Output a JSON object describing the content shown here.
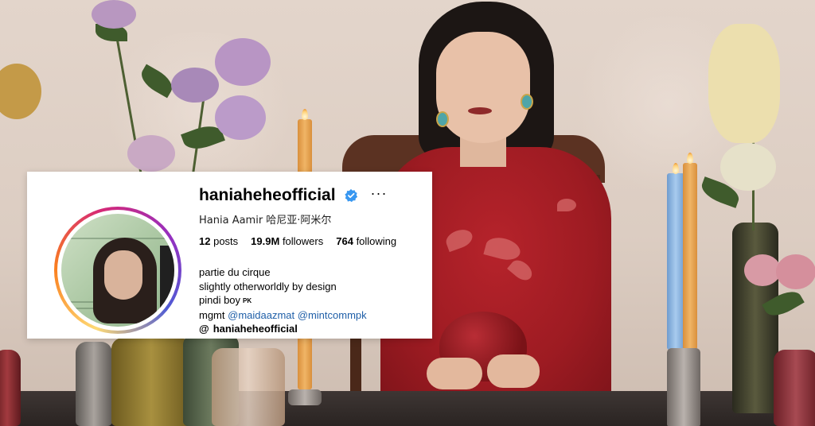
{
  "profile": {
    "username": "haniaheheofficial",
    "verified": true,
    "more_icon": "ellipsis-icon",
    "full_name": "Hania Aamir 哈尼亚·阿米尔",
    "stats": {
      "posts_count": "12",
      "posts_label": "posts",
      "followers_count": "19.9M",
      "followers_label": "followers",
      "following_count": "764",
      "following_label": "following"
    },
    "bio": {
      "line1": "partie du cirque",
      "line2": "slightly otherworldly by design",
      "line3": "pindi boy",
      "line3_tag": "PK",
      "mgmt_label": "mgmt",
      "mention1": "@maidaazmat",
      "mention2": "@mintcommpk",
      "threads_icon": "threads-icon",
      "threads_handle": "haniaheheofficial"
    }
  },
  "colors": {
    "verified_badge": "#3897f0",
    "mention": "#1f5fa8",
    "dress": "#9d1b22",
    "wall": "#e3d5cb"
  }
}
